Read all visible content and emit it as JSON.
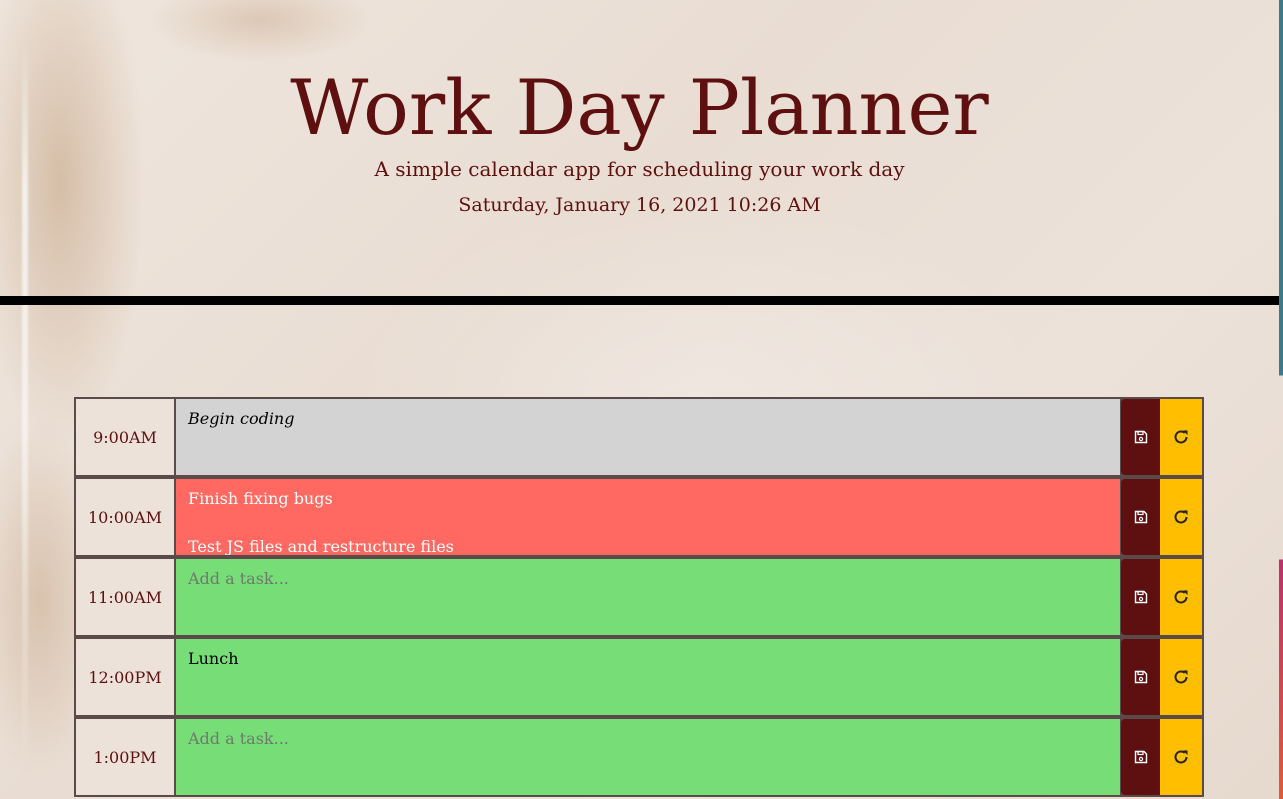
{
  "header": {
    "title": "Work Day Planner",
    "subtitle": "A simple calendar app for scheduling your work day",
    "date": "Saturday, January 16, 2021 10:26 AM"
  },
  "colors": {
    "brand": "#5e1010",
    "past": "#d3d3d3",
    "present": "#ff6961",
    "future": "#77dd77",
    "save_button": "#5e1010",
    "clear_button": "#ffbf00"
  },
  "rows": [
    {
      "hour": "9:00AM",
      "state": "past",
      "task": "Begin coding",
      "placeholder": "Add a task...",
      "save_icon": "floppy-disk-icon",
      "clear_icon": "redo-icon"
    },
    {
      "hour": "10:00AM",
      "state": "present",
      "task": "Finish fixing bugs\n\nTest JS files and restructure files",
      "placeholder": "Add a task...",
      "save_icon": "floppy-disk-icon",
      "clear_icon": "redo-icon"
    },
    {
      "hour": "11:00AM",
      "state": "future",
      "task": "",
      "placeholder": "Add a task...",
      "save_icon": "floppy-disk-icon",
      "clear_icon": "redo-icon"
    },
    {
      "hour": "12:00PM",
      "state": "future",
      "task": "Lunch",
      "placeholder": "Add a task...",
      "save_icon": "floppy-disk-icon",
      "clear_icon": "redo-icon"
    },
    {
      "hour": "1:00PM",
      "state": "future",
      "task": "",
      "placeholder": "Add a task...",
      "save_icon": "floppy-disk-icon",
      "clear_icon": "redo-icon"
    }
  ]
}
